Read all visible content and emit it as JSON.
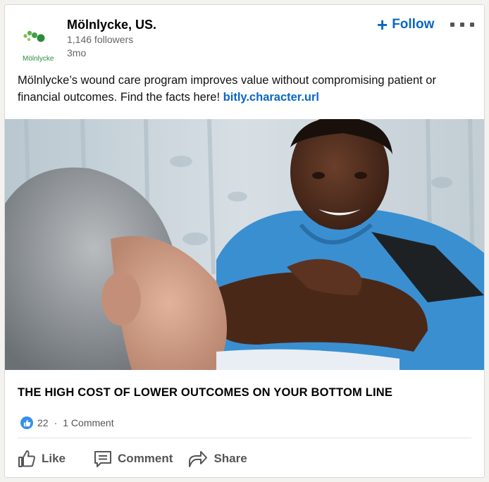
{
  "post": {
    "company_name": "Mölnlycke, US.",
    "logo_text": "Mölnlycke",
    "followers": "1,146 followers",
    "time_ago": "3mo",
    "follow_label": "Follow",
    "body_text": "Mölnlycke’s wound care program improves value without compromising patient or financial outcomes. Find the facts here! ",
    "link_text": "bitly.character.url",
    "headline": "THE HIGH COST OF LOWER OUTCOMES ON YOUR BOTTOM LINE",
    "reactions_count": "22",
    "comments_count": "1 Comment"
  },
  "actions": {
    "like_label": "Like",
    "comment_label": "Comment",
    "share_label": "Share"
  },
  "colors": {
    "link_blue": "#0a66c2",
    "brand_green": "#2e8b3d",
    "reaction_blue": "#378fe9"
  },
  "icons": [
    "plus-icon",
    "more-icon",
    "like-reaction-icon",
    "thumbs-up-icon",
    "comment-icon",
    "share-icon"
  ]
}
